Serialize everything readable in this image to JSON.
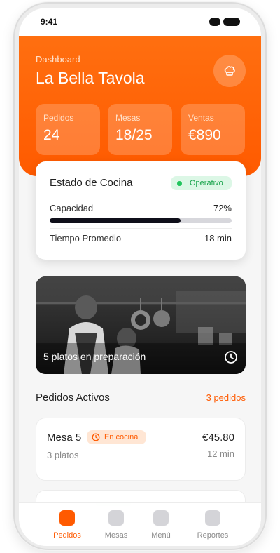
{
  "status_bar": {
    "time": "9:41"
  },
  "header": {
    "subtitle": "Dashboard",
    "title": "La Bella Tavola",
    "chef_icon": "chef-hat-icon",
    "brand_color": "#ff5a00"
  },
  "stats": [
    {
      "label": "Pedidos",
      "value": "24"
    },
    {
      "label": "Mesas",
      "value": "18/25"
    },
    {
      "label": "Ventas",
      "value": "€890"
    }
  ],
  "kitchen": {
    "title": "Estado de Cocina",
    "status": "Operativo",
    "status_color": "#22c55e",
    "capacity_label": "Capacidad",
    "capacity_value": "72%",
    "capacity_fraction": 0.72,
    "avg_time_label": "Tiempo Promedio",
    "avg_time_value": "18 min"
  },
  "banner": {
    "caption": "5 platos en preparación",
    "icon": "clock-icon"
  },
  "active_orders": {
    "title": "Pedidos Activos",
    "count": "3 pedidos",
    "orders": [
      {
        "table": "Mesa 5",
        "status": "En cocina",
        "price": "€45.80",
        "dishes": "3 platos",
        "time": "12 min"
      }
    ]
  },
  "tabbar": {
    "items": [
      {
        "label": "Pedidos",
        "active": true
      },
      {
        "label": "Mesas",
        "active": false
      },
      {
        "label": "Menú",
        "active": false
      },
      {
        "label": "Reportes",
        "active": false
      }
    ]
  }
}
